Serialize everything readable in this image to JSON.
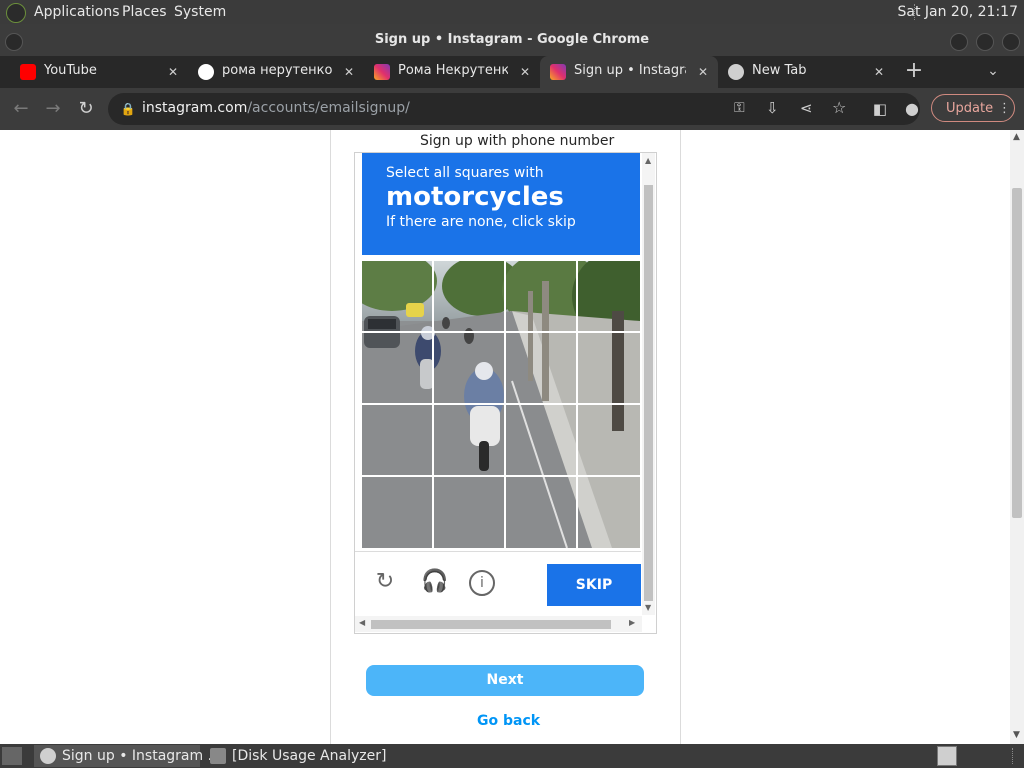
{
  "system_panel": {
    "menus": [
      "Applications",
      "Places",
      "System"
    ],
    "clock": "Sat Jan 20, 21:17"
  },
  "window": {
    "title": "Sign up • Instagram - Google Chrome"
  },
  "tabs": [
    {
      "label": "YouTube",
      "icon": "youtube-icon"
    },
    {
      "label": "рома нерутенко in",
      "icon": "google-icon"
    },
    {
      "label": "Рома Некрутенко",
      "icon": "instagram-icon"
    },
    {
      "label": "Sign up • Instagram",
      "icon": "instagram-icon",
      "active": true
    },
    {
      "label": "New Tab",
      "icon": "chrome-icon"
    }
  ],
  "toolbar": {
    "url_host": "instagram.com",
    "url_path": "/accounts/emailsignup/",
    "update_label": "Update"
  },
  "page": {
    "signup_phone_label": "Sign up with phone number",
    "captcha": {
      "instruction": "Select all squares with",
      "target": "motorcycles",
      "hint": "If there are none, click skip",
      "skip_label": "SKIP",
      "grid_size": 4
    },
    "next_label": "Next",
    "go_back_label": "Go back"
  },
  "taskbar": {
    "items": [
      {
        "label": "Sign up • Instagram ...",
        "active": true
      },
      {
        "label": "[Disk Usage Analyzer]",
        "active": false
      }
    ]
  },
  "colors": {
    "captcha_blue": "#1a73e8",
    "next_button": "#4cb5f9",
    "link_blue": "#0095f6"
  }
}
